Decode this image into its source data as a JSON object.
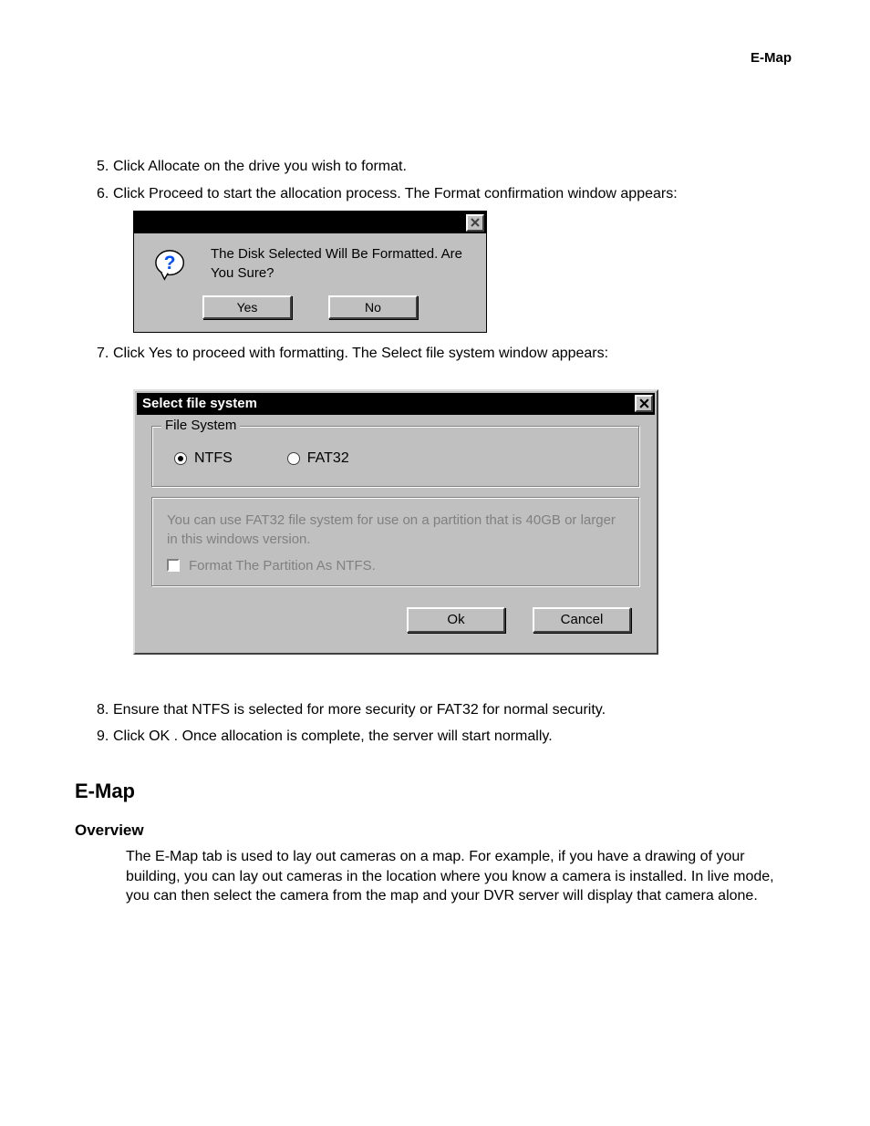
{
  "header": {
    "right": "E-Map"
  },
  "steps_a": [
    {
      "n": "5.",
      "t": "Click Allocate on the drive you wish to format."
    },
    {
      "n": "6.",
      "t": "Click Proceed to start the allocation process. The Format confirmation window appears:"
    }
  ],
  "dlg1": {
    "msg": "The Disk Selected Will Be Formatted. Are You Sure?",
    "yes": "Yes",
    "no": "No"
  },
  "steps_b": [
    {
      "n": "7.",
      "t": "Click Yes to proceed with formatting. The Select file system window appears:"
    }
  ],
  "dlg2": {
    "title": "Select file system",
    "grp": "File System",
    "opt1": "NTFS",
    "opt2": "FAT32",
    "hint": "You can use FAT32 file system for use on a partition that is 40GB or larger in this windows version.",
    "cb": "Format The Partition As NTFS.",
    "ok": "Ok",
    "cancel": "Cancel"
  },
  "steps_c": [
    {
      "n": "8.",
      "t": "Ensure that NTFS is selected for more security or FAT32 for normal security."
    },
    {
      "n": "9.",
      "t": "Click OK . Once allocation is complete, the server will start normally."
    }
  ],
  "section": "E-Map",
  "subsection": "Overview",
  "para": "The E-Map tab is used to lay out cameras on a map. For example, if you have a drawing of your building, you can lay out cameras in the location where you know a camera is installed. In live mode, you can then select the camera from the map and your DVR server will display that camera alone."
}
